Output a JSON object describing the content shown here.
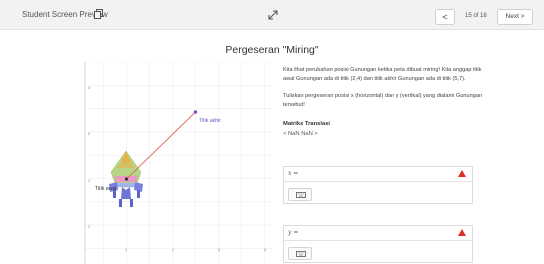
{
  "topbar": {
    "title": "Student Screen Preview",
    "page_indicator": "15 of 18",
    "prev_label": "<",
    "next_label": "Next >"
  },
  "page": {
    "title": "Pergeseran \"Miring\""
  },
  "graph": {
    "start_label": "Titik awal",
    "end_label": "Titik akhir",
    "start_point": [
      2,
      4
    ],
    "end_point": [
      5,
      7
    ],
    "x_ticks": [
      "2",
      "4",
      "6",
      "8"
    ],
    "y_ticks": [
      "8",
      "6",
      "4",
      "2"
    ],
    "colors": {
      "arrow": "#e0715f",
      "end_point": "#6a5acd",
      "axis": "#cccccc",
      "grid": "#ececec"
    }
  },
  "instructions": {
    "p1": "Kita lihat perubahan posisi Gunungan ketika peta dibuat miring! Kita anggap titik awal Gunungan ada di titik (2,4) dan titik akhir Gunungan ada di titik (5,7).",
    "p2": "Tuliskan pergeseran posisi x (horizontal) dan y (vertikal) yang dialami Gunungan tersebut!"
  },
  "matrix": {
    "label": "Matriks Translasi",
    "value": "< NaN NaN >"
  },
  "inputs": {
    "x_label": "x =",
    "y_label": "y ="
  },
  "colors": {
    "warning": "#d93025"
  }
}
